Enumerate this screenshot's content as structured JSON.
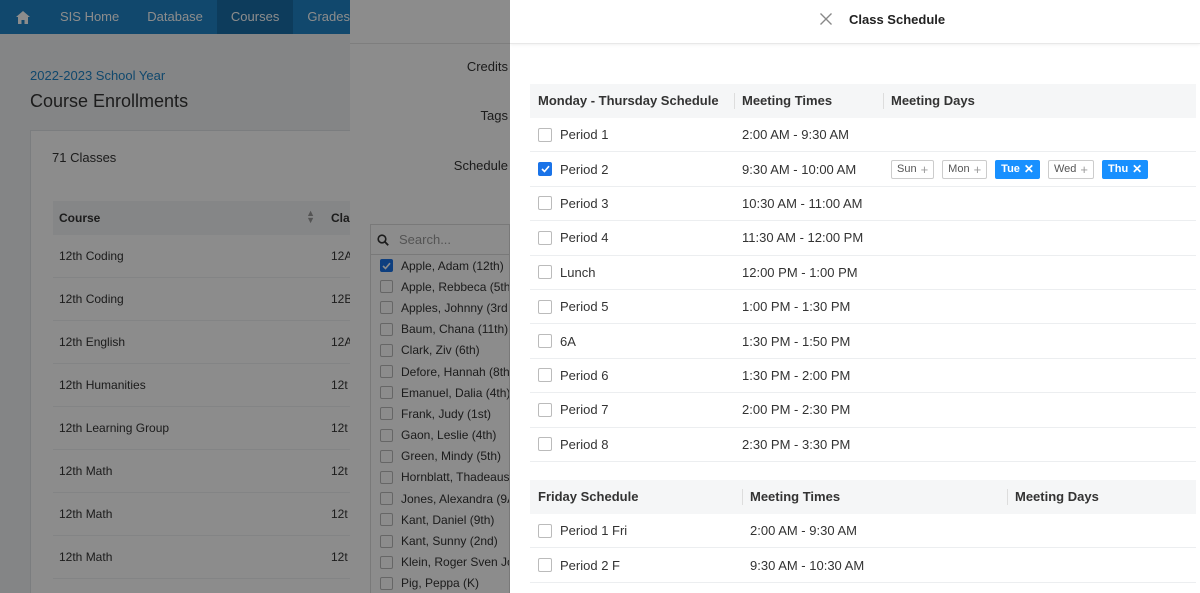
{
  "nav": {
    "items": [
      {
        "label": "SIS Home"
      },
      {
        "label": "Database"
      },
      {
        "label": "Courses",
        "active": true
      },
      {
        "label": "Grades"
      }
    ]
  },
  "page": {
    "school_year": "2022-2023 School Year",
    "title": "Course Enrollments",
    "class_count": "71 Classes"
  },
  "course_table": {
    "headers": [
      "Course",
      "Cla"
    ],
    "rows": [
      [
        "12th Coding",
        "12A"
      ],
      [
        "12th Coding",
        "12B"
      ],
      [
        "12th English",
        "12A"
      ],
      [
        "12th Humanities",
        "12t"
      ],
      [
        "12th Learning Group",
        "12t"
      ],
      [
        "12th Math",
        "12t"
      ],
      [
        "12th Math",
        "12t"
      ],
      [
        "12th Math",
        "12t"
      ]
    ]
  },
  "form": {
    "credits_label": "Credits",
    "tags_label": "Tags",
    "schedule_label": "Schedule",
    "search_placeholder": "Search...",
    "students": [
      {
        "name": "Apple, Adam (12th)",
        "checked": true
      },
      {
        "name": "Apple, Rebbeca (5th",
        "checked": false
      },
      {
        "name": "Apples, Johnny (3rd",
        "checked": false
      },
      {
        "name": "Baum, Chana (11th)",
        "checked": false
      },
      {
        "name": "Clark, Ziv (6th)",
        "checked": false
      },
      {
        "name": "Defore, Hannah (8th",
        "checked": false
      },
      {
        "name": "Emanuel, Dalia (4th)",
        "checked": false
      },
      {
        "name": "Frank, Judy (1st)",
        "checked": false
      },
      {
        "name": "Gaon, Leslie (4th)",
        "checked": false
      },
      {
        "name": "Green, Mindy (5th)",
        "checked": false
      },
      {
        "name": "Hornblatt, Thadeaus",
        "checked": false
      },
      {
        "name": "Jones, Alexandra (9A",
        "checked": false
      },
      {
        "name": "Kant, Daniel (9th)",
        "checked": false
      },
      {
        "name": "Kant, Sunny (2nd)",
        "checked": false
      },
      {
        "name": "Klein, Roger Sven Jo",
        "checked": false
      },
      {
        "name": "Pig, Peppa (K)",
        "checked": false
      }
    ]
  },
  "drawer": {
    "title": "Class Schedule",
    "mt_schedule": {
      "headers": [
        "Monday - Thursday Schedule",
        "Meeting Times",
        "Meeting Days"
      ],
      "rows": [
        {
          "period": "Period 1",
          "time": "2:00 AM - 9:30 AM",
          "checked": false
        },
        {
          "period": "Period 2",
          "time": "9:30 AM - 10:00 AM",
          "checked": true,
          "days": [
            {
              "label": "Sun",
              "selected": false,
              "symbol": "+"
            },
            {
              "label": "Mon",
              "selected": false,
              "symbol": "+"
            },
            {
              "label": "Tue",
              "selected": true,
              "symbol": "✕"
            },
            {
              "label": "Wed",
              "selected": false,
              "symbol": "+"
            },
            {
              "label": "Thu",
              "selected": true,
              "symbol": "✕"
            }
          ]
        },
        {
          "period": "Period 3",
          "time": "10:30 AM - 11:00 AM",
          "checked": false
        },
        {
          "period": "Period 4",
          "time": "11:30 AM - 12:00 PM",
          "checked": false
        },
        {
          "period": "Lunch",
          "time": "12:00 PM - 1:00 PM",
          "checked": false
        },
        {
          "period": "Period 5",
          "time": "1:00 PM - 1:30 PM",
          "checked": false
        },
        {
          "period": "6A",
          "time": "1:30 PM - 1:50 PM",
          "checked": false
        },
        {
          "period": "Period 6",
          "time": "1:30 PM - 2:00 PM",
          "checked": false
        },
        {
          "period": "Period 7",
          "time": "2:00 PM - 2:30 PM",
          "checked": false
        },
        {
          "period": "Period 8",
          "time": "2:30 PM - 3:30 PM",
          "checked": false
        }
      ]
    },
    "fri_schedule": {
      "headers": [
        "Friday Schedule",
        "Meeting Times",
        "Meeting Days"
      ],
      "rows": [
        {
          "period": "Period 1 Fri",
          "time": "2:00 AM - 9:30 AM",
          "checked": false
        },
        {
          "period": "Period 2 F",
          "time": "9:30 AM - 10:30 AM",
          "checked": false
        }
      ]
    }
  },
  "colors": {
    "nav_bg": "#1f84c6",
    "accent": "#1890ff",
    "checkbox_checked": "#1a73e8"
  }
}
